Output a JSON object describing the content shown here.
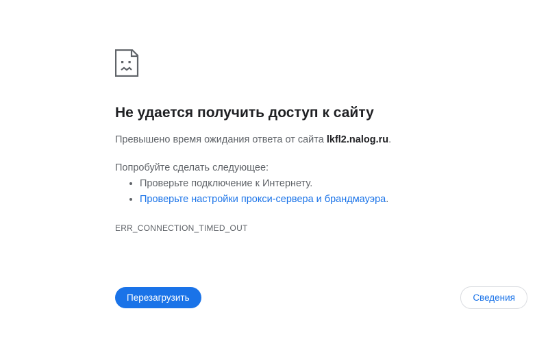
{
  "error": {
    "heading": "Не удается получить доступ к сайту",
    "subtext_prefix": "Превышено время ожидания ответа от сайта ",
    "site": "lkfl2.nalog.ru",
    "subtext_suffix": ".",
    "try_label": "Попробуйте сделать следующее:",
    "suggestions": {
      "item1": "Проверьте подключение к Интернету.",
      "item2_link": "Проверьте настройки прокси-сервера и брандмауэра",
      "item2_suffix": "."
    },
    "code": "ERR_CONNECTION_TIMED_OUT"
  },
  "buttons": {
    "reload": "Перезагрузить",
    "details": "Сведения"
  }
}
